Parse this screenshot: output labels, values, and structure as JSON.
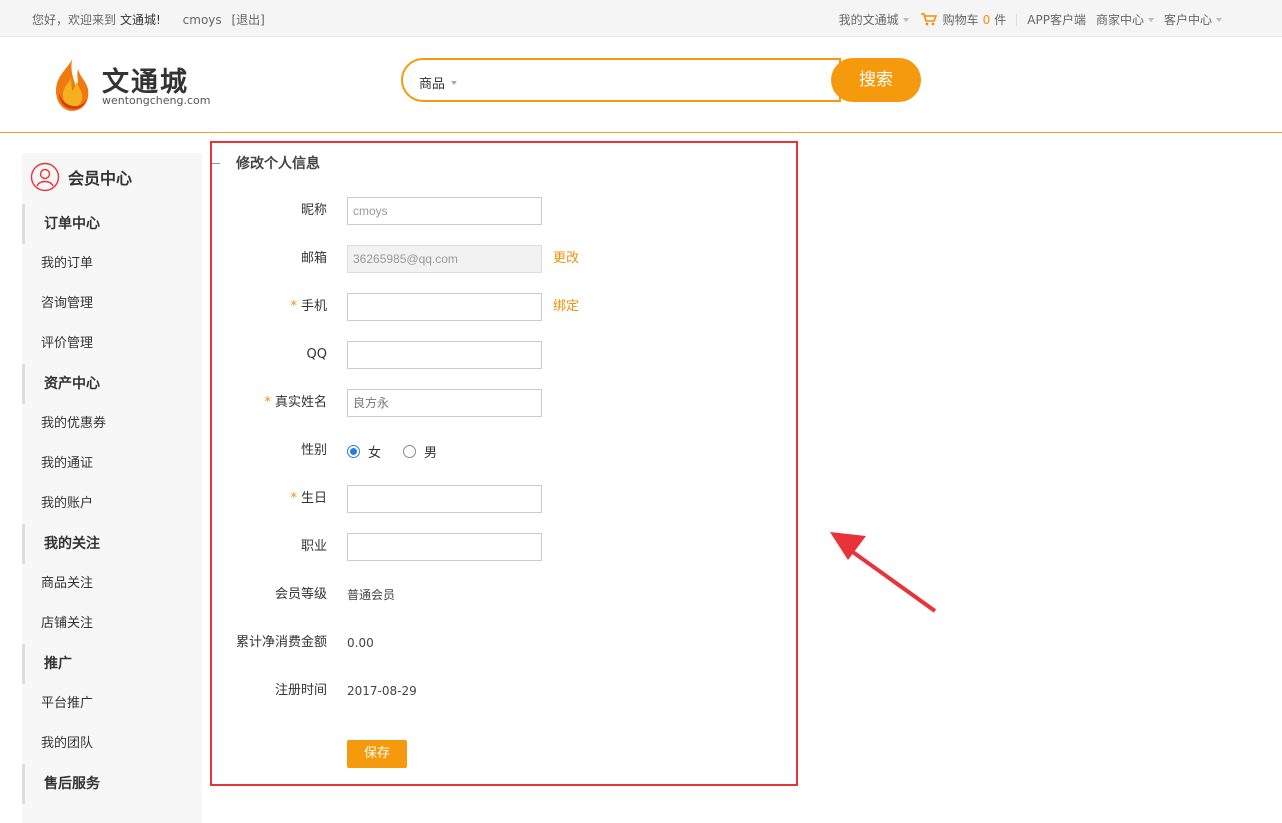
{
  "topbar": {
    "welcome": "您好，欢迎来到",
    "site_name": "文通城!",
    "username": "cmoys",
    "logout": "[退出]",
    "my_site": "我的文通城",
    "cart_label": "购物车",
    "cart_count": "0",
    "cart_unit": "件",
    "app_service": "APP客户端",
    "merchant_center": "商家中心",
    "customer_center": "客户中心"
  },
  "header": {
    "logo_cn": "文通城",
    "logo_en": "wentongcheng.com",
    "search_category": "商品",
    "search_value": "",
    "search_button": "搜索"
  },
  "sidebar": {
    "title": "会员中心",
    "groups": [
      {
        "label": "订单中心",
        "items": [
          "我的订单",
          "咨询管理",
          "评价管理"
        ]
      },
      {
        "label": "资产中心",
        "items": [
          "我的优惠券",
          "我的通证",
          "我的账户"
        ]
      },
      {
        "label": "我的关注",
        "items": [
          "商品关注",
          "店铺关注"
        ]
      },
      {
        "label": "推广",
        "items": [
          "平台推广",
          "我的团队"
        ]
      },
      {
        "label": "售后服务",
        "items": []
      }
    ]
  },
  "form": {
    "title": "修改个人信息",
    "nickname_label": "昵称",
    "nickname_value": "cmoys",
    "email_label": "邮箱",
    "email_value": "36265985@qq.com",
    "email_change": "更改",
    "phone_label": "手机",
    "phone_value": "",
    "phone_bind": "绑定",
    "qq_label": "QQ",
    "qq_value": "",
    "realname_label": "真实姓名",
    "realname_placeholder": "良方永",
    "gender_label": "性别",
    "gender_female": "女",
    "gender_male": "男",
    "gender_selected": "女",
    "birthday_label": "生日",
    "birthday_value": "",
    "job_label": "职业",
    "job_value": "",
    "level_label": "会员等级",
    "level_value": "普通会员",
    "spend_label": "累计净消费金额",
    "spend_value": "0.00",
    "regtime_label": "注册时间",
    "regtime_value": "2017-08-29",
    "required_mark": "*",
    "save_button": "保存"
  },
  "colors": {
    "accent": "#f59a0c",
    "highlight_border": "#e8333a",
    "radio_selected": "#2a7ee0"
  }
}
